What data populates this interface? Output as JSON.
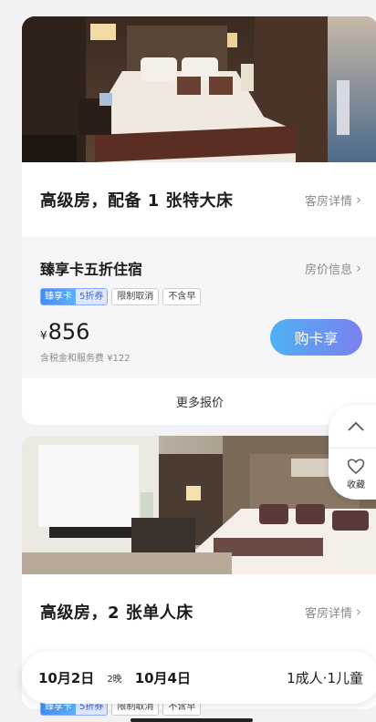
{
  "rooms": [
    {
      "title": "高级房，配备 1 张特大床",
      "detail_label": "客房详情",
      "offer_title": "臻享卡五折住宿",
      "price_info_label": "房价信息",
      "tag_card_a": "臻享卡",
      "tag_card_b": "5折券",
      "tags": [
        "限制取消",
        "不含早"
      ],
      "currency": "¥",
      "price": "856",
      "tax_note": "含税金和服务费 ¥122",
      "buy_label": "购卡享",
      "more_label": "更多报价"
    },
    {
      "title": "高级房，2 张单人床",
      "detail_label": "客房详情"
    }
  ],
  "side": {
    "favorite_label": "收藏"
  },
  "booking": {
    "checkin": "10月2日",
    "nights": "2晚",
    "checkout": "10月4日",
    "guests": "1成人·1儿童"
  },
  "bottom_tags": {
    "card_a": "臻享卡",
    "card_b": "5折券",
    "tags": [
      "限制取消",
      "不含早"
    ]
  },
  "colors": {
    "accent_start": "#4fb1f4",
    "accent_end": "#7b80f0"
  },
  "icons": [
    "chevron-right-icon",
    "chevron-up-icon",
    "heart-icon"
  ]
}
